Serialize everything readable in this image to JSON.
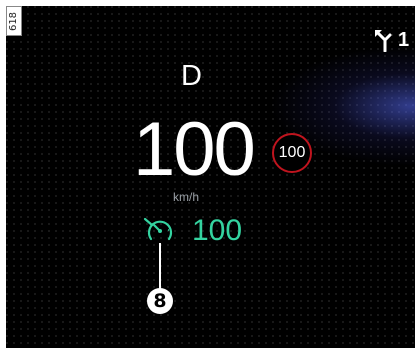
{
  "figure_id": "618",
  "cluster": {
    "gear": "D",
    "speed": "100",
    "speed_unit": "km/h",
    "speed_limit": "100",
    "cruise_set_speed": "100",
    "navigation_text": "1"
  },
  "callout_number": "8",
  "colors": {
    "background": "#000000",
    "text": "#ffffff",
    "cruise": "#34d3a0",
    "limit_ring": "#c0141e",
    "glow": "#5a6eff"
  },
  "icons": {
    "navigation": "turn-arrow-icon",
    "cruise": "speed-limiter-icon"
  }
}
